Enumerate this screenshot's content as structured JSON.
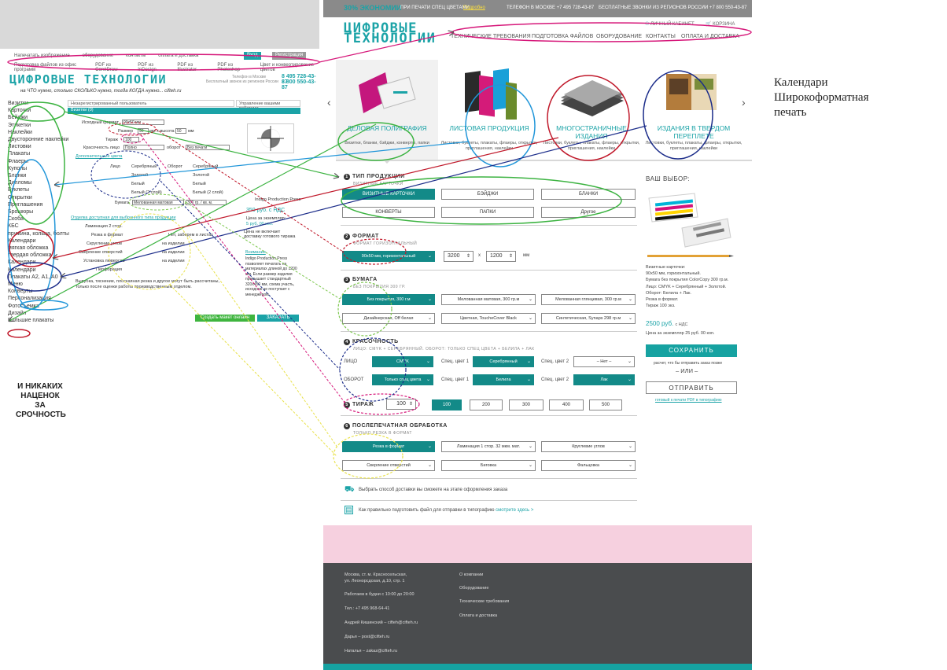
{
  "old_site": {
    "nav": [
      "Напечатать изображение",
      "оборудование",
      "контакты",
      "оплата и доставка"
    ],
    "nav2": [
      "Подготовка файлов из офис программ",
      "PDF из CorelDraw",
      "PDF из InDesign",
      "PDF из Illustrator",
      "PDF из Photoshop",
      "Цвет и конвертирование цветов"
    ],
    "logo": "ЦИФРОВЫЕ ТЕХНОЛОГИИ",
    "slogan": "на ЧТО нужно, столько СКОЛЬКО нужно, тогда КОГДА нужно... cifteh.ru",
    "phone1": "8 495 728-43-87",
    "phone2": "8 800 550-43-87",
    "phone_label1": "Телефон в Москве",
    "phone_label2": "Бесплатный звонок из регионов России",
    "sidebar": [
      "Визитки",
      "Карточки",
      "Бейджи",
      "Этикетки",
      "Наклейки",
      "Двусторонние наклейки",
      "Листовки",
      "Плакаты",
      "Флаеры",
      "Купоны",
      "Бланки",
      "Дипломы",
      "Буклеты",
      "Открытки",
      "Приглашения",
      "Брошюры",
      "Скоба",
      "КБС",
      "пружина, кольца, болты",
      "Календари",
      "мягкая обложка",
      "твердая обложка",
      "Календари",
      "Календари",
      "Плакаты А2, А1, А0",
      "Меню",
      "Конверты",
      "Персонализация",
      "Фотосъемка",
      "Дизайн",
      "Большие плакаты"
    ],
    "user_bar": "Незарегистрированный пользователь",
    "manage_bar": "Управление вашими работами",
    "section": "Визитки (0)",
    "fields": {
      "format_label": "Исходный формат",
      "format_value": "90x50 мм",
      "size_label": "Размер",
      "w": "90",
      "h": "50",
      "mm": "мм",
      "x_label": "мм x высота",
      "tirazh_label": "Тираж",
      "tirazh_value": "100",
      "color_label": "Красочность лицо",
      "color_value": "Полно",
      "oborot_label": "оборот",
      "oborot_value": "Без печати",
      "extra_colors": "Дополнительные цвета",
      "face": "Лицо",
      "back": "Оборот",
      "c1": "Серебряный",
      "c2": "Золотой",
      "c3": "Белый",
      "c4": "Белый (2 слой)",
      "paper_label": "Бумага",
      "paper_value": "Мелованная матовая",
      "paper_weight": "300 гр. / кв. м.",
      "finish_title": "Отделка доступная для выбранного типа продукции",
      "f1": "Ламинация 2 стор.",
      "f2": "Резка в формат",
      "f3": "Скругление углов",
      "f4": "Сверление отверстий",
      "f5": "Установка люверсов",
      "f6": "Перфорация",
      "on_item": "на изделии",
      "not_on_item": "Нет, заберем в листах",
      "comment": "Вырубка, тиснение, плоскаяная резка и другое могут быть рассчитаны, только после оценки работы производственным отделом.",
      "press": "Indigo Production Press",
      "price": "350 руб. с НДС",
      "price_label": "Цена за экземпляр:",
      "price_each": "5 руб. 00 коп.",
      "press_note": "Цена не включает доставку готового тиража",
      "attention": "Внимание",
      "attention_text": "Indigo Production Press позволяет печатать на материалах длиной до 1200 мм. Если размер изделия превышает стандартный 320х450 мм, схема участь, исходник не поступает с менеджером.",
      "btn_create": "Создать макет онлайн",
      "btn_order": "ЗАКАЗАТЬ"
    },
    "slogan_big": "И НИКАКИХ НАЦЕНОК ЗА СРОЧНОСТЬ",
    "tab1": "Вход",
    "tab2": "Регистрация"
  },
  "new_site": {
    "promo": "30% ЭКОНОМИИ",
    "promo_text": "ПРИ ПЕЧАТИ СПЕЦ ЦВЕТАМИ",
    "promo_link": "Подробно",
    "phone_msk": "ТЕЛЕФОН В МОСКВЕ +7 495 728-43-87",
    "phone_free": "БЕСПЛАТНЫЕ ЗВОНКИ ИЗ РЕГИОНОВ РОССИИ +7 800 550-43-87",
    "logo1": "ЦИФРОВЫЕ",
    "logo2": "ТЕХНОЛОГИИ",
    "account": "ЛИЧНЫЙ КАБИНЕТ",
    "cart": "КОРЗИНА",
    "nav": [
      "ТЕХНИЧЕСКИЕ ТРЕБОВАНИЯ",
      "ПОДГОТОВКА ФАЙЛОВ",
      "ОБОРУДОВАНИЕ",
      "КОНТАКТЫ",
      "ОПЛАТА И ДОСТАВКА"
    ],
    "slides": [
      {
        "title": "ДЕЛОВАЯ ПОЛИГРАФИЯ",
        "desc": "Визитки, бланки, бэйджи, конверты, папки"
      },
      {
        "title": "ЛИСТОВАЯ ПРОДУКЦИЯ",
        "desc": "Листовки, буклеты, плакаты, флаеры, открытки, приглашения, наклейки"
      },
      {
        "title": "МНОГОСТРАНИЧНЫЕ ИЗДАНИЯ",
        "desc": "Листовки, буклеты, плакаты, флаеры, открытки, приглашения, наклейки"
      },
      {
        "title": "ИЗДАНИЯ В ТВЕРДОМ ПЕРЕПЛЕТЕ",
        "desc": "Листовки, буклеты, плакаты, флаеры, открытки, приглашения, наклейки"
      }
    ],
    "s1": {
      "num": "1",
      "title": "ТИП ПРОДУКЦИИ",
      "sub": "ВИЗИТНЫЕ КАРТОЧКИ",
      "options": [
        "ВИЗИТНЫЕ КАРТОЧКИ",
        "БЭЙДЖИ",
        "БЛАНКИ",
        "КОНВЕРТЫ",
        "ПАПКИ",
        "Другое"
      ]
    },
    "s2": {
      "num": "2",
      "title": "ФОРМАТ",
      "sub": "ФОРМАТ ГОРИЗОНТАЛЬНЫЙ",
      "format": "90х50 мм, горизонтальный",
      "w": "3200",
      "h": "1200",
      "x": "x",
      "unit": "мм"
    },
    "s3": {
      "num": "3",
      "title": "БУМАГА",
      "sub": "БЕЗ ПОКРЫТИЯ 300 ГР.",
      "papers": [
        "Без покрытия, 300 г.м",
        "Мелованная матовая, 300 гр.м",
        "Мелованная глянцевая, 300 гр.м",
        "Дизайнерская, Off белая",
        "Цветная, ToucheCover Black",
        "Синтетическая, Synaps 298 гр.м"
      ]
    },
    "s4": {
      "num": "4",
      "title": "КРАСОЧНОСТЬ",
      "sub": "ЛИЦО: CMYK + СЕРЕБРЯННЫЙ. ОБОРОТ: ТОЛЬКО СПЕЦ ЦВЕТА + БЕЛИЛА + ЛАК",
      "face": "ЛИЦО",
      "back": "ОБОРОТ",
      "face_val": "CMYK",
      "back_val": "Только спец цвета",
      "spec1": "Спец. цвет 1",
      "spec2": "Спец. цвет 2",
      "face_s1": "Серебрянный",
      "face_s2": "– Нет –",
      "back_s1": "Белила",
      "back_s2": "Лак"
    },
    "s5": {
      "num": "5",
      "title": "ТИРАЖ",
      "value": "100",
      "options": [
        "100",
        "200",
        "300",
        "400",
        "500"
      ]
    },
    "s6": {
      "num": "6",
      "title": "ПОСЛЕПЕЧАТНАЯ ОБРАБОТКА",
      "sub": "ТОЛЬКО РЕЗКА В ФОРМАТ",
      "options": [
        "Резка в формат",
        "Ламинация 1 стор. 32 мкм. мат.",
        "Круглевие углов",
        "Сверление отверстий",
        "Биговка",
        "Фальцовка"
      ]
    },
    "delivery": "Выбрать способ доставки вы сможете на этапе оформления заказа",
    "prepare": "Как правильно подготовить файл для отправки в типографию",
    "prepare_link": "смотрите здесь  >",
    "choice_title": "ВАШ ВЫБОР:",
    "choice_text": [
      "Визитные карточки:",
      "90х50 мм, горизонтальный.",
      "Бумага без покрытия ColorCopy 300 гр.м.",
      "Лицо: CMYK + Серебрянный + Золотой.",
      "Оборот: Белила + Лак.",
      "Резка в формат.",
      "Тираж 100 экз."
    ],
    "choice_price": "2500 руб.",
    "choice_vat": "с НДС",
    "choice_each": "Цена за экземпляр 25 руб. 00 коп.",
    "save_btn": "СОХРАНИТЬ",
    "save_note": "расчет, что бы отправить заказ позже",
    "or": "– ИЛИ –",
    "send_btn": "ОТПРАВИТЬ",
    "send_note": "готовый к печати PDF в типографию",
    "footer": {
      "addr1": "Москва, ст. м. Красносельская,",
      "addr2": "ул. Леонорсдская, д.10, стр. 1",
      "hours": "Работаем в будни с 10:00 до 20:00",
      "tel": "Тел.: +7 495 968-64-41",
      "p1": "Андрей Кишинский – cifteh@cifteh.ru",
      "p2": "Дарья – post@cifteh.ru",
      "p3": "Наталья – zakaz@cifteh.ru",
      "links": [
        "О компании",
        "Оборудование",
        "Технические требования",
        "Оплата и доставка"
      ]
    }
  },
  "note": [
    "Календари",
    "Широкоформатная",
    "печать"
  ],
  "colors": {
    "teal": "#1ba3a7",
    "teal_dark": "#138a88",
    "annot_red": "#c0182a",
    "annot_green": "#3cb341",
    "annot_blue": "#2196d9",
    "annot_navy": "#1c2d8a",
    "annot_magenta": "#d6187a",
    "annot_yellow": "#e9e24a",
    "annot_lime": "#7ec850"
  }
}
